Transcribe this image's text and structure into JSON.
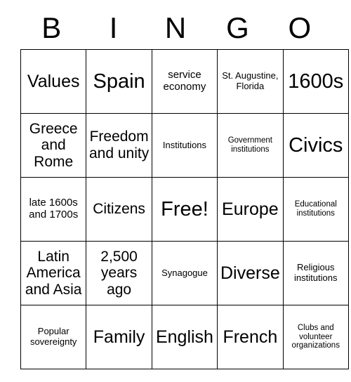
{
  "card": {
    "header_letters": [
      "B",
      "I",
      "N",
      "G",
      "O"
    ],
    "columns": [
      "B",
      "I",
      "N",
      "G",
      "O"
    ],
    "free_space_label": "Free!",
    "grid": [
      [
        {
          "text": "Values",
          "size": "lg"
        },
        {
          "text": "Spain",
          "size": "xl"
        },
        {
          "text": "service economy",
          "size": "sm"
        },
        {
          "text": "St. Augustine, Florida",
          "size": "xs"
        },
        {
          "text": "1600s",
          "size": "xl"
        }
      ],
      [
        {
          "text": "Greece and Rome",
          "size": "md"
        },
        {
          "text": "Freedom and unity",
          "size": "md"
        },
        {
          "text": "Institutions",
          "size": "xs"
        },
        {
          "text": "Government institutions",
          "size": "xxs"
        },
        {
          "text": "Civics",
          "size": "xl"
        }
      ],
      [
        {
          "text": "late 1600s and 1700s",
          "size": "sm"
        },
        {
          "text": "Citizens",
          "size": "md"
        },
        {
          "text": "Free!",
          "size": "xl"
        },
        {
          "text": "Europe",
          "size": "lg"
        },
        {
          "text": "Educational institutions",
          "size": "xxs"
        }
      ],
      [
        {
          "text": "Latin America and Asia",
          "size": "md"
        },
        {
          "text": "2,500 years ago",
          "size": "md"
        },
        {
          "text": "Synagogue",
          "size": "xs"
        },
        {
          "text": "Diverse",
          "size": "lg"
        },
        {
          "text": "Religious institutions",
          "size": "xs"
        }
      ],
      [
        {
          "text": "Popular sovereignty",
          "size": "xs"
        },
        {
          "text": "Family",
          "size": "lg"
        },
        {
          "text": "English",
          "size": "lg"
        },
        {
          "text": "French",
          "size": "lg"
        },
        {
          "text": "Clubs and volunteer organizations",
          "size": "xxs"
        }
      ]
    ]
  },
  "colors": {
    "background": "#ffffff",
    "text": "#000000",
    "border": "#000000"
  }
}
